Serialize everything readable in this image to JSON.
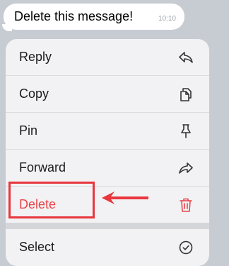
{
  "message": {
    "text": "Delete this message!",
    "time": "10:10"
  },
  "menu": {
    "items": [
      {
        "label": "Reply",
        "icon": "reply-icon"
      },
      {
        "label": "Copy",
        "icon": "copy-icon"
      },
      {
        "label": "Pin",
        "icon": "pin-icon"
      },
      {
        "label": "Forward",
        "icon": "forward-icon"
      },
      {
        "label": "Delete",
        "icon": "trash-icon",
        "color": "#e8454a"
      },
      {
        "label": "Select",
        "icon": "check-circle-icon"
      }
    ]
  },
  "annotation": {
    "highlight_color": "#e8363c",
    "highlight_target": "Delete"
  }
}
